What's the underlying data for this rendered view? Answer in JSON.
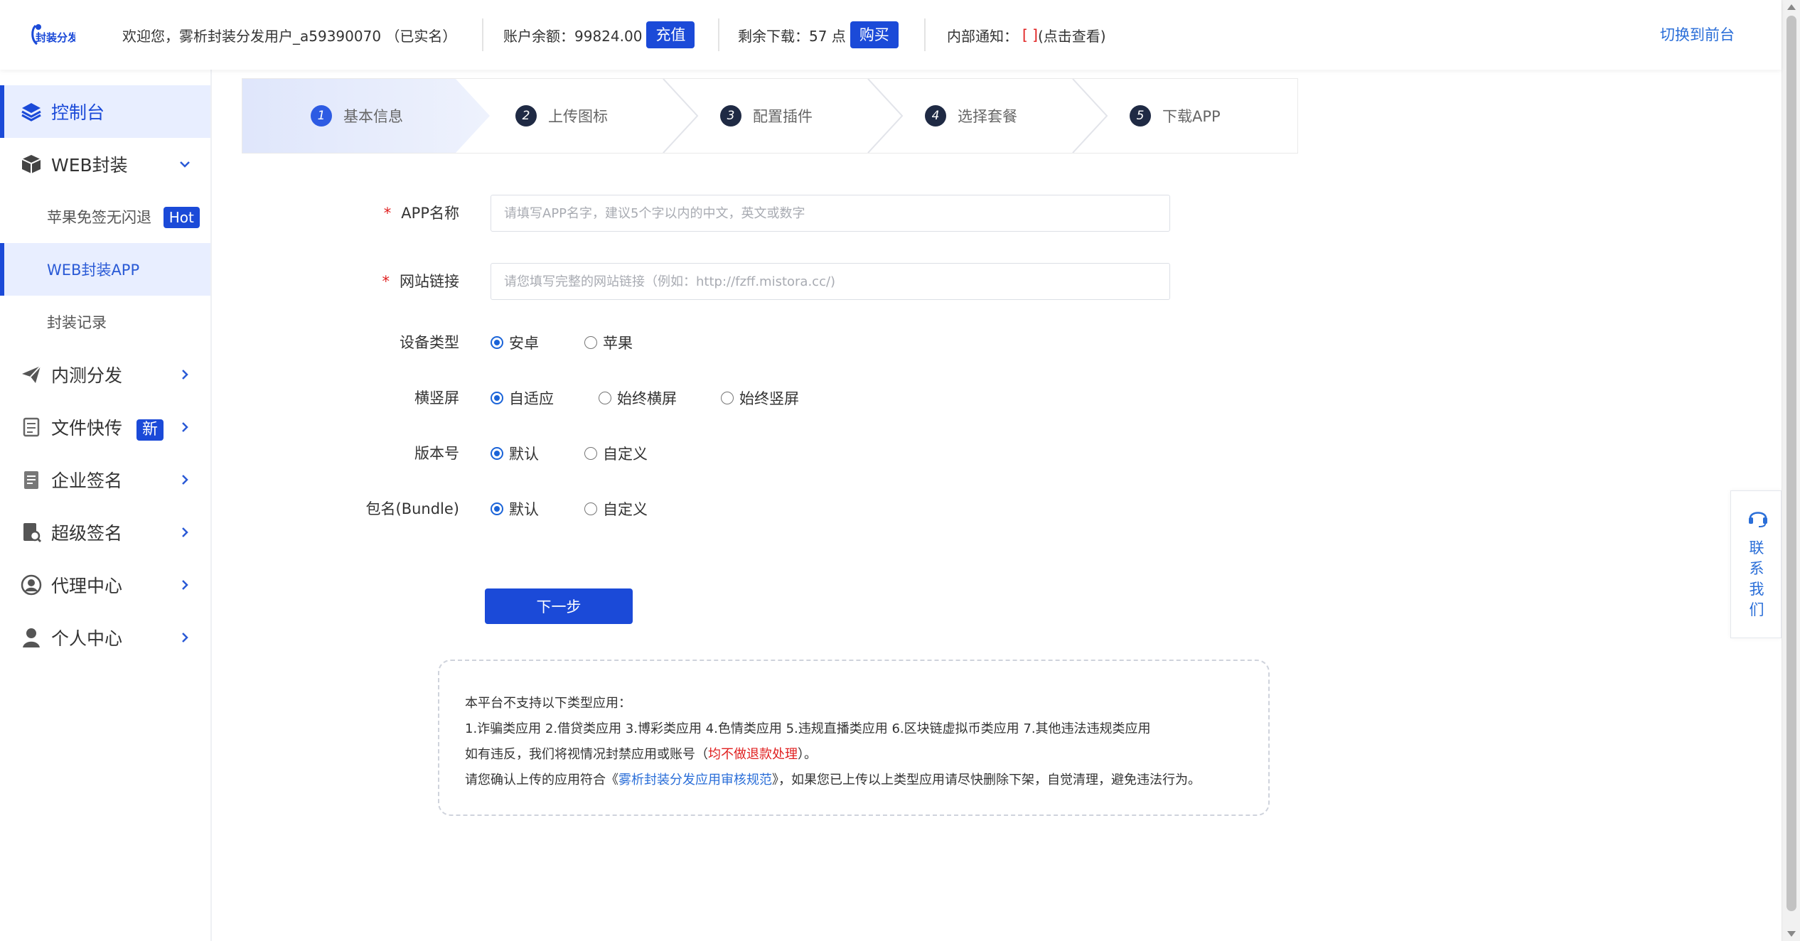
{
  "header": {
    "logo_text": "封装分发",
    "welcome": "欢迎您，雾析封装分发用户_a59390070 （已实名）",
    "balance_label": "账户余额：99824.00",
    "recharge_button": "充值",
    "downloads_label": "剩余下载：57 点",
    "buy_button": "购买",
    "notice_label": "内部通知：",
    "notice_brackets": "[ ]",
    "notice_view": "(点击查看)",
    "switch_link": "切换到前台"
  },
  "sidebar": {
    "console": "控制台",
    "web_wrap": "WEB封装",
    "sub_apple": "苹果免签无闪退",
    "sub_apple_badge": "Hot",
    "sub_webapp": "WEB封装APP",
    "sub_records": "封装记录",
    "beta": "内测分发",
    "file_transfer": "文件快传",
    "file_badge": "新",
    "enterprise_sign": "企业签名",
    "super_sign": "超级签名",
    "agent": "代理中心",
    "personal": "个人中心"
  },
  "steps": [
    {
      "num": "1",
      "label": "基本信息"
    },
    {
      "num": "2",
      "label": "上传图标"
    },
    {
      "num": "3",
      "label": "配置插件"
    },
    {
      "num": "4",
      "label": "选择套餐"
    },
    {
      "num": "5",
      "label": "下载APP"
    }
  ],
  "form": {
    "app_name_label": "APP名称",
    "app_name_placeholder": "请填写APP名字，建议5个字以内的中文，英文或数字",
    "site_link_label": "网站链接",
    "site_link_placeholder": "请您填写完整的网站链接（例如：http://fzff.mistora.cc/)",
    "device_label": "设备类型",
    "device_android": "安卓",
    "device_apple": "苹果",
    "orientation_label": "横竖屏",
    "orient_auto": "自适应",
    "orient_landscape": "始终横屏",
    "orient_portrait": "始终竖屏",
    "version_label": "版本号",
    "version_default": "默认",
    "version_custom": "自定义",
    "bundle_label": "包名(Bundle)",
    "bundle_default": "默认",
    "bundle_custom": "自定义",
    "next_button": "下一步"
  },
  "notice": {
    "line1": "本平台不支持以下类型应用：",
    "line2": "1.诈骗类应用 2.借贷类应用 3.博彩类应用 4.色情类应用 5.违规直播类应用 6.区块链虚拟币类应用 7.其他违法违规类应用",
    "line3_a": "如有违反，我们将视情况封禁应用或账号（",
    "line3_red": "均不做退款处理",
    "line3_b": "）。",
    "line4_a": "请您确认上传的应用符合《",
    "line4_link": "雾析封装分发应用审核规范",
    "line4_b": "》，如果您已上传以上类型应用请尽快删除下架，自觉清理，避免违法行为。"
  },
  "contact": {
    "text": "联系我们"
  },
  "colors": {
    "primary": "#1b4ad8",
    "link": "#2a6ed8",
    "danger": "#e02020",
    "active_bg": "#e8eeff"
  }
}
